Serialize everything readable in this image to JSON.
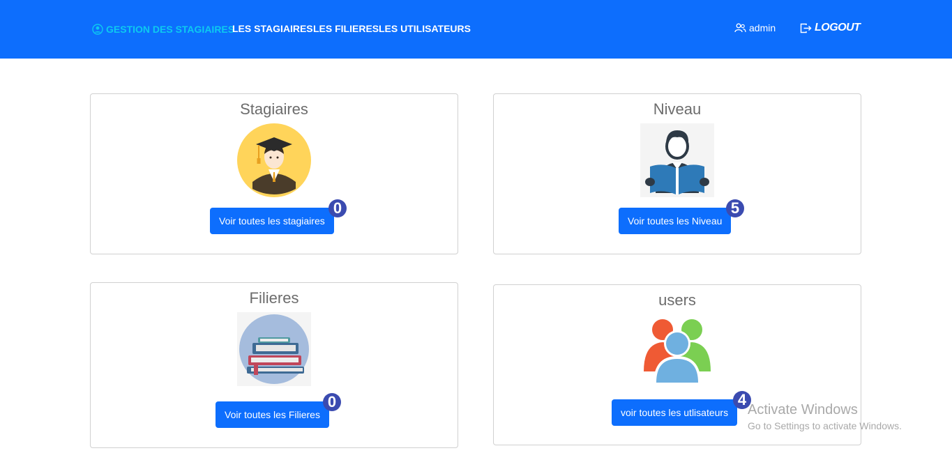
{
  "nav": {
    "brand": "GESTION DES STAGIAIRES",
    "links": [
      "LES STAGIAIRES",
      "LES FILIERES",
      "LES UTILISATEURS"
    ],
    "user": "admin",
    "logout": "LOGOUT",
    "colors": {
      "bar": "#0d6efd",
      "brand": "#0dcaf0"
    }
  },
  "cards": [
    {
      "title": "Stagiaires",
      "button": "Voir toutes les stagiaires",
      "count": "0",
      "icon": "graduate-icon"
    },
    {
      "title": "Niveau",
      "button": "Voir toutes les Niveau",
      "count": "5",
      "icon": "reader-icon"
    },
    {
      "title": "Filieres",
      "button": "Voir toutes les Filieres",
      "count": "0",
      "icon": "books-icon"
    },
    {
      "title": "users",
      "button": "voir toutes les utlisateurs",
      "count": "4",
      "icon": "users-icon"
    }
  ],
  "watermark": {
    "title": "Activate Windows",
    "subtitle": "Go to Settings to activate Windows."
  }
}
